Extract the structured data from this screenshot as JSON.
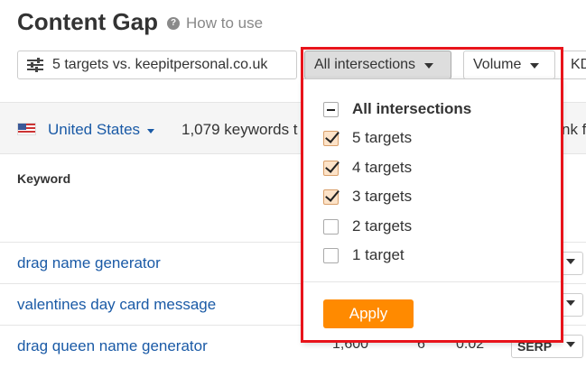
{
  "header": {
    "title": "Content Gap",
    "help_icon": "?",
    "how_to_use": "How to use"
  },
  "filters": {
    "targets_label": "5 targets vs. keepitpersonal.co.uk",
    "intersections_label": "All intersections",
    "volume_label": "Volume",
    "kd_label": "KD"
  },
  "country_bar": {
    "country": "United States",
    "keywords_count": "1,079 keywords t",
    "right_text": "nk fo"
  },
  "table": {
    "column_keyword": "Keyword",
    "rows": [
      {
        "keyword": "drag name generator"
      },
      {
        "keyword": "valentines day card message"
      },
      {
        "keyword": "drag queen name generator",
        "volume": "1,600",
        "kd": "6",
        "cpc": "0.02",
        "serp": "SERP"
      }
    ]
  },
  "dropdown": {
    "options": [
      {
        "label": "All intersections",
        "state": "indeterminate"
      },
      {
        "label": "5 targets",
        "state": "checked"
      },
      {
        "label": "4 targets",
        "state": "checked"
      },
      {
        "label": "3 targets",
        "state": "checked"
      },
      {
        "label": "2 targets",
        "state": "unchecked"
      },
      {
        "label": "1 target",
        "state": "unchecked"
      }
    ],
    "apply_label": "Apply"
  },
  "colors": {
    "accent_orange": "#ff8a00",
    "link_blue": "#1a5aa6",
    "highlight_red": "#e8141b"
  }
}
